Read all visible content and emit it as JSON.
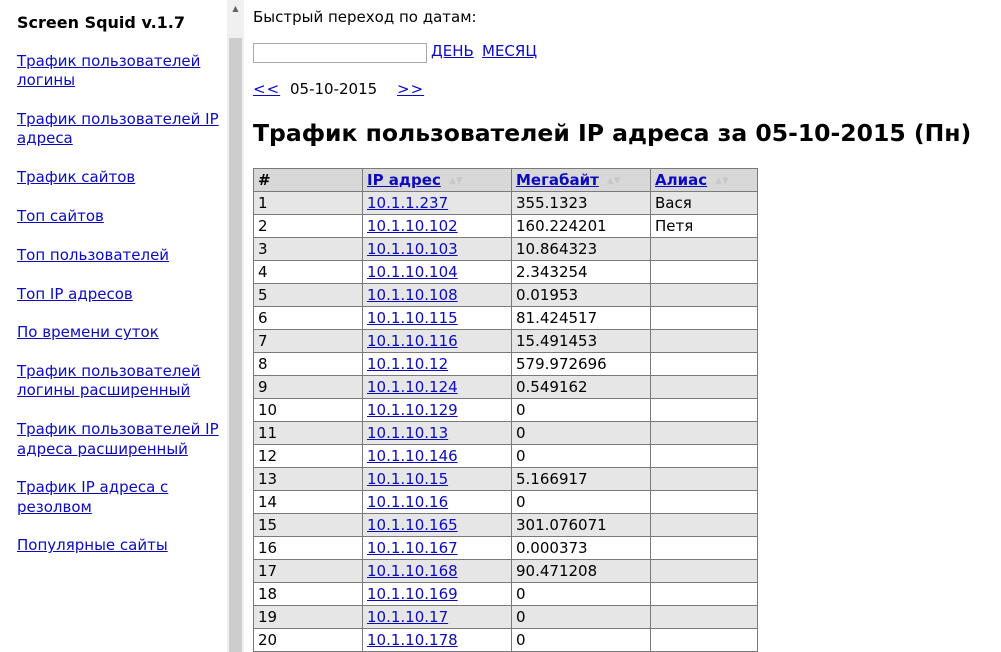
{
  "app_title": "Screen Squid v.1.7",
  "nav": [
    {
      "label": "Трафик пользователей логины"
    },
    {
      "label": "Трафик пользователей IP адреса"
    },
    {
      "label": "Трафик сайтов"
    },
    {
      "label": "Топ сайтов"
    },
    {
      "label": "Топ пользователей"
    },
    {
      "label": "Топ IP адресов"
    },
    {
      "label": "По времени суток"
    },
    {
      "label": "Трафик пользователей логины расширенный"
    },
    {
      "label": "Трафик пользователей IP адреса расширенный"
    },
    {
      "label": "Трафик IP адреса с резолвом"
    },
    {
      "label": "Популярные сайты"
    }
  ],
  "quick_jump": {
    "label": "Быстрый переход по датам:",
    "input_value": "",
    "day_link": "ДЕНЬ",
    "month_link": "МЕСЯЦ"
  },
  "date_nav": {
    "prev": "<<",
    "current": "05-10-2015",
    "next": ">>"
  },
  "page_title": "Трафик пользователей IP адреса за 05-10-2015 (Пн)",
  "table": {
    "headers": {
      "num": "#",
      "ip": "IP адрес",
      "mb": "Мегабайт",
      "alias": "Алиас"
    },
    "rows": [
      {
        "n": "1",
        "ip": "10.1.1.237",
        "mb": "355.1323",
        "alias": "Вася"
      },
      {
        "n": "2",
        "ip": "10.1.10.102",
        "mb": "160.224201",
        "alias": "Петя"
      },
      {
        "n": "3",
        "ip": "10.1.10.103",
        "mb": "10.864323",
        "alias": ""
      },
      {
        "n": "4",
        "ip": "10.1.10.104",
        "mb": "2.343254",
        "alias": ""
      },
      {
        "n": "5",
        "ip": "10.1.10.108",
        "mb": "0.01953",
        "alias": ""
      },
      {
        "n": "6",
        "ip": "10.1.10.115",
        "mb": "81.424517",
        "alias": ""
      },
      {
        "n": "7",
        "ip": "10.1.10.116",
        "mb": "15.491453",
        "alias": ""
      },
      {
        "n": "8",
        "ip": "10.1.10.12",
        "mb": "579.972696",
        "alias": ""
      },
      {
        "n": "9",
        "ip": "10.1.10.124",
        "mb": "0.549162",
        "alias": ""
      },
      {
        "n": "10",
        "ip": "10.1.10.129",
        "mb": "0",
        "alias": ""
      },
      {
        "n": "11",
        "ip": "10.1.10.13",
        "mb": "0",
        "alias": ""
      },
      {
        "n": "12",
        "ip": "10.1.10.146",
        "mb": "0",
        "alias": ""
      },
      {
        "n": "13",
        "ip": "10.1.10.15",
        "mb": "5.166917",
        "alias": ""
      },
      {
        "n": "14",
        "ip": "10.1.10.16",
        "mb": "0",
        "alias": ""
      },
      {
        "n": "15",
        "ip": "10.1.10.165",
        "mb": "301.076071",
        "alias": ""
      },
      {
        "n": "16",
        "ip": "10.1.10.167",
        "mb": "0.000373",
        "alias": ""
      },
      {
        "n": "17",
        "ip": "10.1.10.168",
        "mb": "90.471208",
        "alias": ""
      },
      {
        "n": "18",
        "ip": "10.1.10.169",
        "mb": "0",
        "alias": ""
      },
      {
        "n": "19",
        "ip": "10.1.10.17",
        "mb": "0",
        "alias": ""
      },
      {
        "n": "20",
        "ip": "10.1.10.178",
        "mb": "0",
        "alias": ""
      }
    ]
  }
}
